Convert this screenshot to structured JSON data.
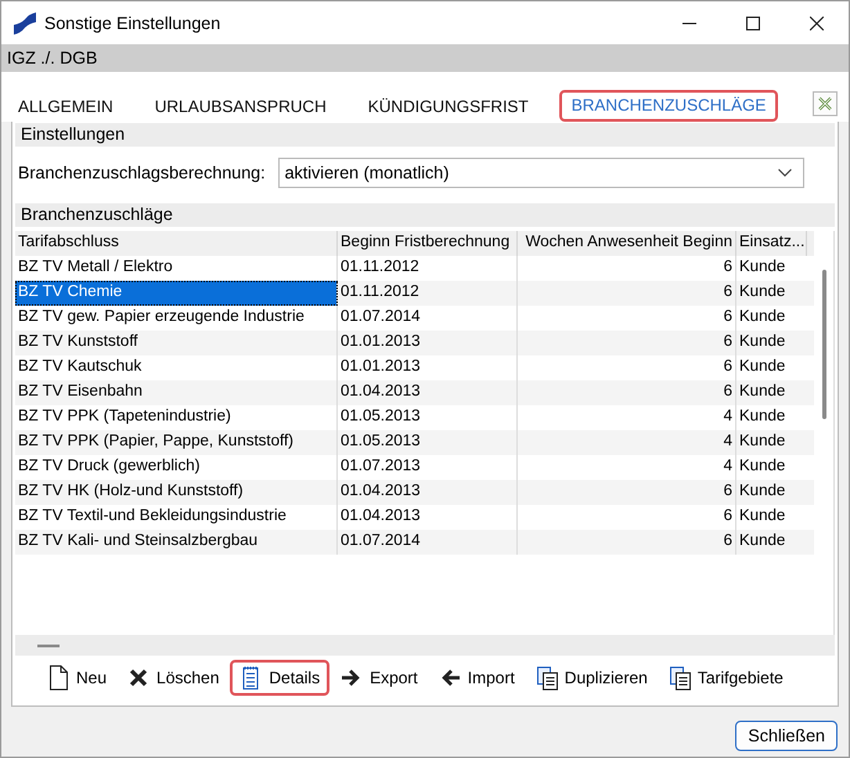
{
  "window": {
    "title": "Sonstige Einstellungen"
  },
  "subtitle": "IGZ ./. DGB",
  "tabs": [
    {
      "label": "ALLGEMEIN",
      "selected": false,
      "highlighted": false
    },
    {
      "label": "URLAUBSANSPRUCH",
      "selected": false,
      "highlighted": false
    },
    {
      "label": "KÜNDIGUNGSFRIST",
      "selected": false,
      "highlighted": false
    },
    {
      "label": "BRANCHENZUSCHLÄGE",
      "selected": true,
      "highlighted": true
    }
  ],
  "settings": {
    "heading": "Einstellungen",
    "label": "Branchenzuschlagsberechnung:",
    "value": "aktivieren (monatlich)"
  },
  "table": {
    "heading": "Branchenzuschläge",
    "columns": [
      "Tarifabschluss",
      "Beginn Fristberechnung",
      "Wochen Anwesenheit Beginn",
      "Einsatz..."
    ],
    "rows": [
      {
        "cells": [
          "BZ TV Metall / Elektro",
          "01.11.2012",
          "6",
          "Kunde"
        ],
        "selected": false
      },
      {
        "cells": [
          "BZ TV Chemie",
          "01.11.2012",
          "6",
          "Kunde"
        ],
        "selected": true
      },
      {
        "cells": [
          "BZ TV gew. Papier erzeugende Industrie",
          "01.07.2014",
          "6",
          "Kunde"
        ],
        "selected": false
      },
      {
        "cells": [
          "BZ TV Kunststoff",
          "01.01.2013",
          "6",
          "Kunde"
        ],
        "selected": false
      },
      {
        "cells": [
          "BZ TV Kautschuk",
          "01.01.2013",
          "6",
          "Kunde"
        ],
        "selected": false
      },
      {
        "cells": [
          "BZ TV Eisenbahn",
          "01.04.2013",
          "6",
          "Kunde"
        ],
        "selected": false
      },
      {
        "cells": [
          "BZ TV PPK (Tapetenindustrie)",
          "01.05.2013",
          "4",
          "Kunde"
        ],
        "selected": false
      },
      {
        "cells": [
          "BZ TV PPK (Papier, Pappe, Kunststoff)",
          "01.05.2013",
          "4",
          "Kunde"
        ],
        "selected": false
      },
      {
        "cells": [
          "BZ TV Druck (gewerblich)",
          "01.07.2013",
          "4",
          "Kunde"
        ],
        "selected": false
      },
      {
        "cells": [
          "BZ TV HK (Holz-und Kunststoff)",
          "01.04.2013",
          "6",
          "Kunde"
        ],
        "selected": false
      },
      {
        "cells": [
          "BZ TV Textil-und Bekleidungsindustrie",
          "01.04.2013",
          "6",
          "Kunde"
        ],
        "selected": false
      },
      {
        "cells": [
          "BZ TV Kali- und Steinsalzbergbau",
          "01.07.2014",
          "6",
          "Kunde"
        ],
        "selected": false
      }
    ]
  },
  "toolbar": [
    {
      "label": "Neu",
      "kind": "new",
      "highlighted": false
    },
    {
      "label": "Löschen",
      "kind": "delete",
      "highlighted": false
    },
    {
      "label": "Details",
      "kind": "details",
      "highlighted": true
    },
    {
      "label": "Export",
      "kind": "export",
      "highlighted": false
    },
    {
      "label": "Import",
      "kind": "import",
      "highlighted": false
    },
    {
      "label": "Duplizieren",
      "kind": "copy",
      "highlighted": false
    },
    {
      "label": "Tarifgebiete",
      "kind": "copy",
      "highlighted": false
    }
  ],
  "buttons": [
    "Schließen"
  ]
}
